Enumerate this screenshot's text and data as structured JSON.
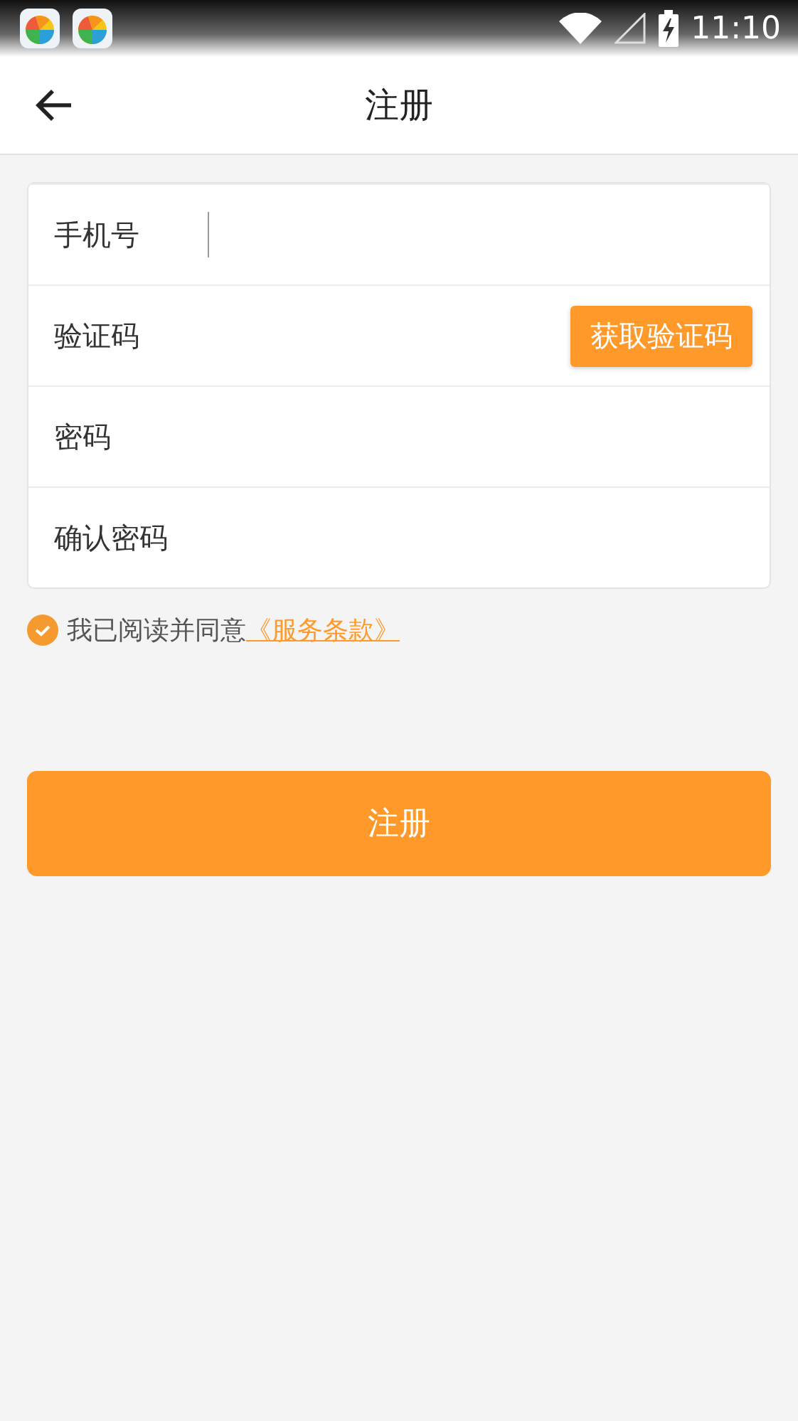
{
  "status_bar": {
    "time": "11:10"
  },
  "header": {
    "title": "注册"
  },
  "form": {
    "fields": [
      {
        "kind": "text",
        "label": "手机号",
        "focused": true
      },
      {
        "kind": "code",
        "label": "验证码",
        "focused": false,
        "button": "获取验证码"
      },
      {
        "kind": "text",
        "label": "密码",
        "focused": false
      },
      {
        "kind": "text",
        "label": "确认密码",
        "focused": false
      }
    ]
  },
  "agreement": {
    "checked": true,
    "text": "我已阅读并同意",
    "link": "《服务条款》"
  },
  "submit_button": "注册"
}
